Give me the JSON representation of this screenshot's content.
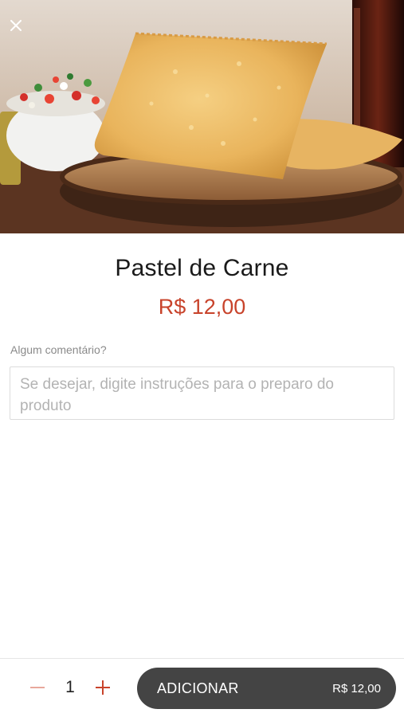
{
  "header": {
    "close_icon": "close-icon",
    "hero_image": "pastel-photo"
  },
  "product": {
    "name": "Pastel de Carne",
    "price": "R$ 12,00"
  },
  "comment": {
    "label": "Algum comentário?",
    "placeholder": "Se desejar, digite instruções para o preparo do produto",
    "value": ""
  },
  "footer": {
    "quantity": "1",
    "minus_icon": "minus-icon",
    "plus_icon": "plus-icon",
    "add_label": "ADICIONAR",
    "add_total": "R$ 12,00"
  },
  "colors": {
    "accent": "#c8432b",
    "button_bg": "#444444",
    "text": "#1a1a1a",
    "muted": "#8a8a8a"
  }
}
